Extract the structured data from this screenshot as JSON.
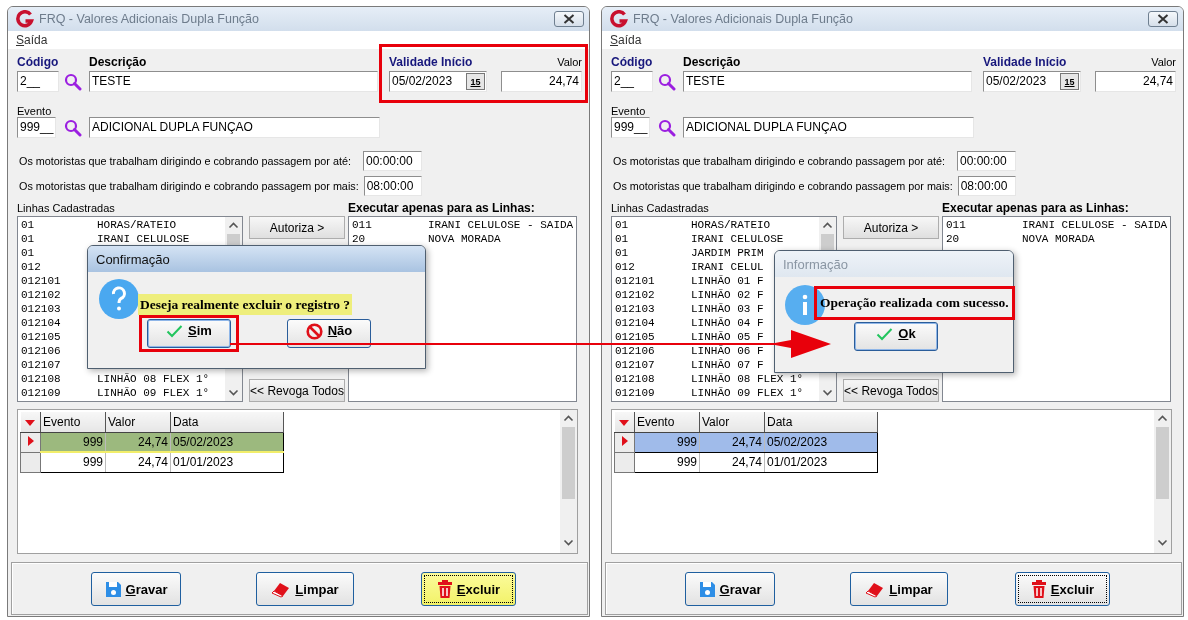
{
  "arrow": true,
  "windows": [
    {
      "title": "FRQ - Valores Adicionais Dupla Função",
      "active": false,
      "menu": [
        "Saída"
      ],
      "form": {
        "codigo_label": "Código",
        "codigo": "2__",
        "descricao_label": "Descrição",
        "descricao": "TESTE",
        "validade_label": "Validade Início",
        "validade": "05/02/2023",
        "calendar": "15",
        "valor_label": "Valor",
        "valor": "24,74",
        "framed": true,
        "evento_label": "Evento",
        "evento": "999__",
        "evento_descricao": "ADICIONAL DUPLA FUNÇAO"
      },
      "motoristas": [
        {
          "label": "Os motoristas que trabalham dirigindo e cobrando passagem por até:",
          "value": "00:00:00"
        },
        {
          "label": "Os motoristas que trabalham dirigindo e cobrando passagem por mais:",
          "value": "08:00:00"
        }
      ],
      "linhas": {
        "label": "Linhas Cadastradas",
        "items": [
          {
            "code": "01",
            "name": "HORAS/RATEIO"
          },
          {
            "code": "01",
            "name": "IRANI CELULOSE"
          },
          {
            "code": "01"
          },
          {
            "code": "012"
          },
          {
            "code": "012101"
          },
          {
            "code": "012102"
          },
          {
            "code": "012103"
          },
          {
            "code": "012104"
          },
          {
            "code": "012105"
          },
          {
            "code": "012106"
          },
          {
            "code": "012107"
          },
          {
            "code": "012108",
            "name": "LINHÃO 08 FLEX 1°"
          },
          {
            "code": "012109",
            "name": "LINHÃO 09 FLEX 1°"
          }
        ]
      },
      "autoriza": "Autoriza >",
      "revoga": "<< Revoga Todos",
      "executar": {
        "label": "Executar apenas para as Linhas:",
        "items": [
          {
            "code": "011",
            "name": "IRANI CELULOSE - SAIDA"
          },
          {
            "code": "20",
            "name": "NOVA MORADA"
          }
        ]
      },
      "grid": {
        "focused": true,
        "columns": [
          "Evento",
          "Valor",
          "Data"
        ],
        "rows": [
          {
            "cells": [
              "999",
              "24,74",
              "05/02/2023"
            ],
            "selected": true
          },
          {
            "cells": [
              "999",
              "24,74",
              "01/01/2023"
            ],
            "selected": false
          }
        ]
      },
      "buttons": [
        {
          "label": "Gravar",
          "kind": "save",
          "focused": false,
          "highlighted": false
        },
        {
          "label": "Limpar",
          "kind": "clear",
          "focused": false,
          "highlighted": false
        },
        {
          "label": "Excluir",
          "kind": "delete",
          "focused": true,
          "highlighted": true
        }
      ],
      "dialog": {
        "kind": "question",
        "title": "Confirmação",
        "active": true,
        "message": "Deseja realmente excluir o registro ?",
        "message_highlighted": true,
        "message_framed": false,
        "buttons": [
          {
            "label": "Sim",
            "kind": "yes",
            "framed": true
          },
          {
            "label": "Não",
            "kind": "no",
            "framed": false
          }
        ]
      }
    },
    {
      "title": "FRQ - Valores Adicionais Dupla Função",
      "active": false,
      "menu": [
        "Saída"
      ],
      "form": {
        "codigo_label": "Código",
        "codigo": "2__",
        "descricao_label": "Descrição",
        "descricao": "TESTE",
        "validade_label": "Validade Início",
        "validade": "05/02/2023",
        "calendar": "15",
        "valor_label": "Valor",
        "valor": "24,74",
        "framed": false,
        "evento_label": "Evento",
        "evento": "999__",
        "evento_descricao": "ADICIONAL DUPLA FUNÇAO"
      },
      "motoristas": [
        {
          "label": "Os motoristas que trabalham dirigindo e cobrando passagem por até:",
          "value": "00:00:00"
        },
        {
          "label": "Os motoristas que trabalham dirigindo e cobrando passagem por mais:",
          "value": "08:00:00"
        }
      ],
      "linhas": {
        "label": "Linhas Cadastradas",
        "items": [
          {
            "code": "01",
            "name": "HORAS/RATEIO"
          },
          {
            "code": "01",
            "name": "IRANI CELULOSE"
          },
          {
            "code": "01",
            "name": "JARDIM PRIM"
          },
          {
            "code": "012",
            "name": "IRANI CELUL"
          },
          {
            "code": "012101",
            "name": "LINHÃO 01 F"
          },
          {
            "code": "012102",
            "name": "LINHÃO 02 F"
          },
          {
            "code": "012103",
            "name": "LINHÃO 03 F"
          },
          {
            "code": "012104",
            "name": "LINHÃO 04 F"
          },
          {
            "code": "012105",
            "name": "LINHÃO 05 F"
          },
          {
            "code": "012106",
            "name": "LINHÃO 06 F"
          },
          {
            "code": "012107",
            "name": "LINHÃO 07 F"
          },
          {
            "code": "012108",
            "name": "LINHÃO 08 FLEX 1°"
          },
          {
            "code": "012109",
            "name": "LINHÃO 09 FLEX 1°"
          }
        ]
      },
      "autoriza": "Autoriza >",
      "revoga": "<< Revoga Todos",
      "executar": {
        "label": "Executar apenas para as Linhas:",
        "items": [
          {
            "code": "011",
            "name": "IRANI CELULOSE - SAIDA"
          },
          {
            "code": "20",
            "name": "NOVA MORADA"
          }
        ]
      },
      "grid": {
        "focused": false,
        "columns": [
          "Evento",
          "Valor",
          "Data"
        ],
        "rows": [
          {
            "cells": [
              "999",
              "24,74",
              "05/02/2023"
            ],
            "selected": true
          },
          {
            "cells": [
              "999",
              "24,74",
              "01/01/2023"
            ],
            "selected": false
          }
        ]
      },
      "buttons": [
        {
          "label": "Gravar",
          "kind": "save",
          "focused": false,
          "highlighted": false
        },
        {
          "label": "Limpar",
          "kind": "clear",
          "focused": false,
          "highlighted": false
        },
        {
          "label": "Excluir",
          "kind": "delete",
          "focused": true,
          "highlighted": false
        }
      ],
      "dialog": {
        "kind": "info",
        "title": "Informação",
        "active": false,
        "message": "Operação realizada com sucesso.",
        "message_highlighted": false,
        "message_framed": true,
        "buttons": [
          {
            "label": "Ok",
            "kind": "ok",
            "framed": false
          }
        ]
      }
    }
  ]
}
